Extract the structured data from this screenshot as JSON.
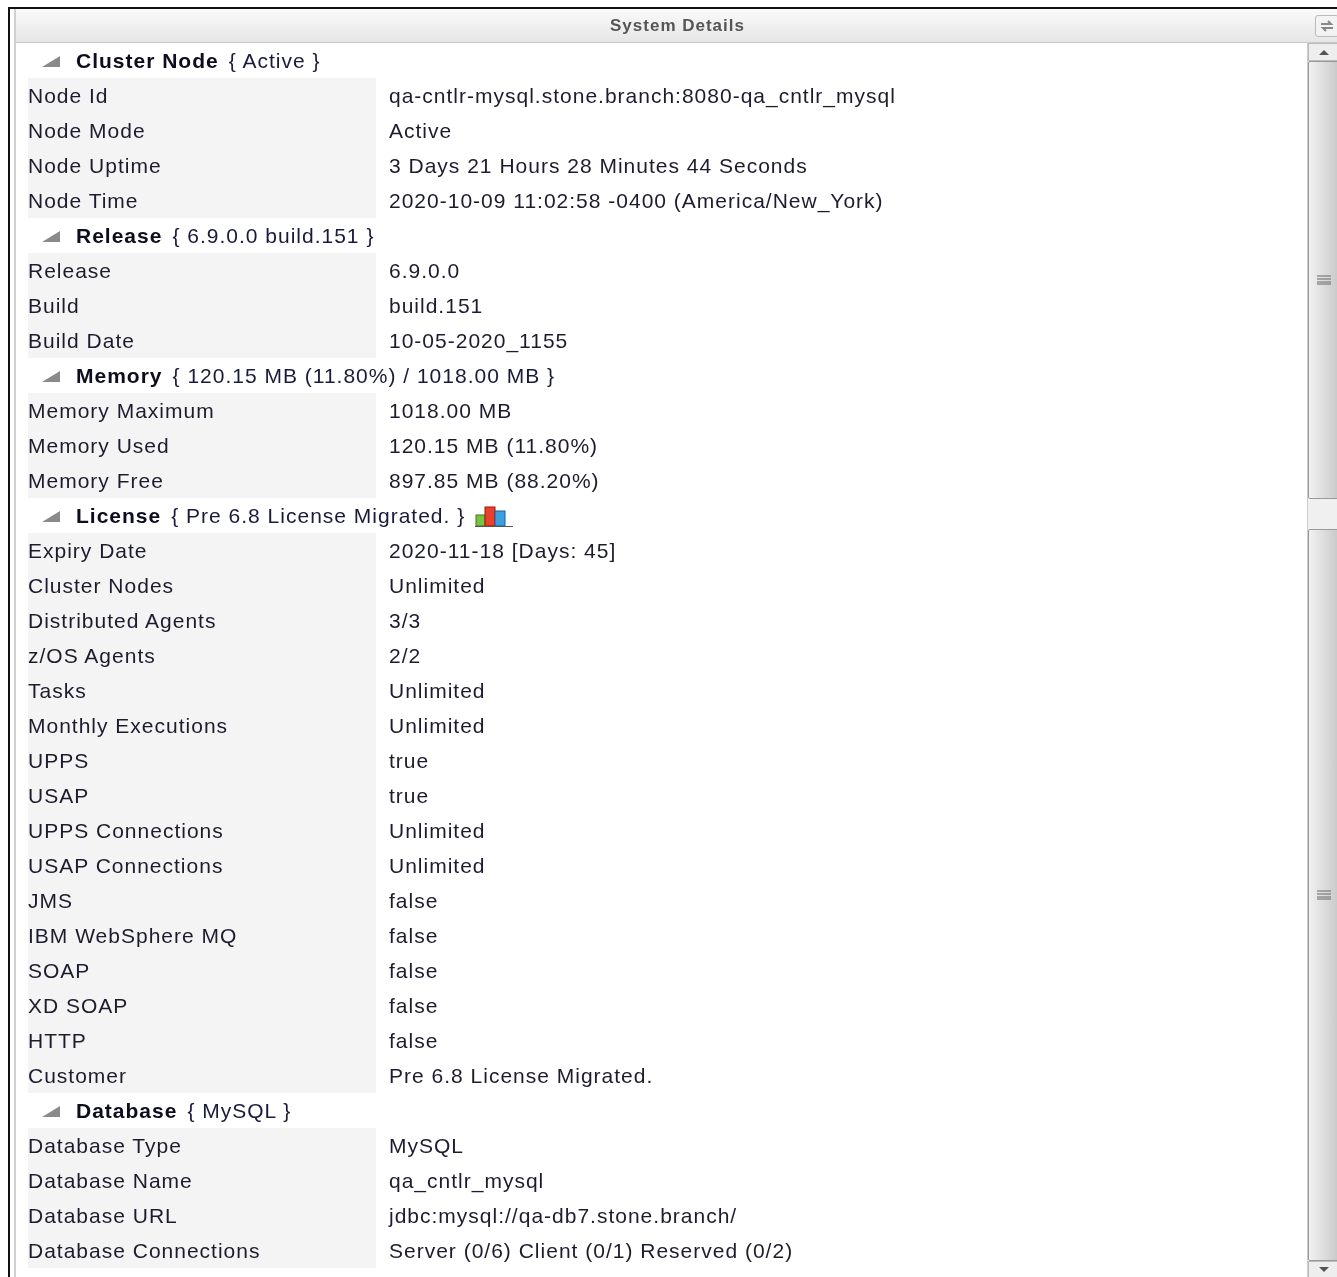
{
  "window": {
    "title": "System Details"
  },
  "sections": [
    {
      "title": "Cluster Node",
      "summary": "{ Active }",
      "expanded": true,
      "rows": [
        {
          "label": "Node Id",
          "value": "qa-cntlr-mysql.stone.branch:8080-qa_cntlr_mysql"
        },
        {
          "label": "Node Mode",
          "value": "Active"
        },
        {
          "label": "Node Uptime",
          "value": "3 Days 21 Hours 28 Minutes 44 Seconds"
        },
        {
          "label": "Node Time",
          "value": "2020-10-09 11:02:58 -0400 (America/New_York)"
        }
      ]
    },
    {
      "title": "Release",
      "summary": "{ 6.9.0.0 build.151 }",
      "expanded": true,
      "rows": [
        {
          "label": "Release",
          "value": "6.9.0.0"
        },
        {
          "label": "Build",
          "value": "build.151"
        },
        {
          "label": "Build Date",
          "value": "10-05-2020_1155"
        }
      ]
    },
    {
      "title": "Memory",
      "summary": "{ 120.15 MB (11.80%) / 1018.00 MB }",
      "expanded": true,
      "rows": [
        {
          "label": "Memory Maximum",
          "value": "1018.00 MB"
        },
        {
          "label": "Memory Used",
          "value": "120.15 MB (11.80%)"
        },
        {
          "label": "Memory Free",
          "value": "897.85 MB (88.20%)"
        }
      ]
    },
    {
      "title": "License",
      "summary": "{ Pre 6.8 License Migrated. }",
      "expanded": true,
      "chart_icon": true,
      "rows": [
        {
          "label": "Expiry Date",
          "value": "2020-11-18 [Days: 45]"
        },
        {
          "label": "Cluster Nodes",
          "value": "Unlimited"
        },
        {
          "label": "Distributed Agents",
          "value": "3/3"
        },
        {
          "label": "z/OS Agents",
          "value": "2/2"
        },
        {
          "label": "Tasks",
          "value": "Unlimited"
        },
        {
          "label": "Monthly Executions",
          "value": "Unlimited"
        },
        {
          "label": "UPPS",
          "value": "true"
        },
        {
          "label": "USAP",
          "value": "true"
        },
        {
          "label": "UPPS Connections",
          "value": "Unlimited"
        },
        {
          "label": "USAP Connections",
          "value": "Unlimited"
        },
        {
          "label": "JMS",
          "value": "false"
        },
        {
          "label": "IBM WebSphere MQ",
          "value": "false"
        },
        {
          "label": "SOAP",
          "value": "false"
        },
        {
          "label": "XD SOAP",
          "value": "false"
        },
        {
          "label": "HTTP",
          "value": "false"
        },
        {
          "label": "Customer",
          "value": "Pre 6.8 License Migrated."
        }
      ]
    },
    {
      "title": "Database",
      "summary": "{ MySQL }",
      "expanded": true,
      "rows": [
        {
          "label": "Database Type",
          "value": "MySQL"
        },
        {
          "label": "Database Name",
          "value": "qa_cntlr_mysql"
        },
        {
          "label": "Database URL",
          "value": "jdbc:mysql://qa-db7.stone.branch/"
        },
        {
          "label": "Database Connections",
          "value": "Server (0/6) Client (0/1) Reserved (0/2)"
        }
      ]
    }
  ]
}
